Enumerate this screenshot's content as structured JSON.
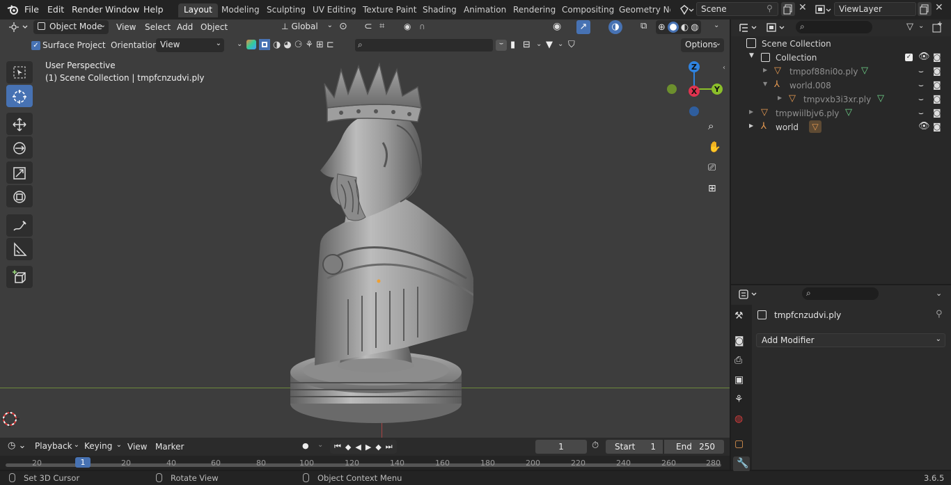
{
  "menu": {
    "items": [
      "File",
      "Edit",
      "Render",
      "Window",
      "Help"
    ]
  },
  "workspaces": [
    "Layout",
    "Modeling",
    "Sculpting",
    "UV Editing",
    "Texture Paint",
    "Shading",
    "Animation",
    "Rendering",
    "Compositing",
    "Geometry Noc"
  ],
  "scene": {
    "name": "Scene",
    "view_layer": "ViewLayer"
  },
  "viewport": {
    "mode": "Object Mode",
    "menus": [
      "View",
      "Select",
      "Add",
      "Object"
    ],
    "transform_orientation": "Global",
    "surface_project_label": "Surface Project",
    "orientation_label": "Orientation:",
    "orientation_value": "View",
    "options_label": "Options",
    "overlay_line1": "User Perspective",
    "overlay_line2": "(1) Scene Collection | tmpfcnzudvi.ply",
    "gizmo_axes": {
      "z": "Z",
      "x": "X",
      "y": "Y"
    }
  },
  "outliner": {
    "root": "Scene Collection",
    "rows": [
      {
        "label": "Collection"
      },
      {
        "label": "tmpof88ni0o.ply"
      },
      {
        "label": "world.008"
      },
      {
        "label": "tmpvxb3i3xr.ply"
      },
      {
        "label": "tmpwiilbjv6.ply"
      },
      {
        "label": "world"
      }
    ]
  },
  "properties": {
    "object_name": "tmpfcnzudvi.ply",
    "add_modifier_label": "Add Modifier"
  },
  "timeline": {
    "menus": [
      "Playback",
      "Keying",
      "View",
      "Marker"
    ],
    "current_frame": "1",
    "start_label": "Start",
    "start_value": "1",
    "end_label": "End",
    "end_value": "250",
    "ticks": [
      "20",
      "1",
      "20",
      "40",
      "60",
      "80",
      "100",
      "120",
      "140",
      "160",
      "180",
      "200",
      "220",
      "240",
      "260",
      "280"
    ]
  },
  "status": {
    "hint1": "Set 3D Cursor",
    "hint2": "Rotate View",
    "hint3": "Object Context Menu",
    "version": "3.6.5"
  },
  "colors": {
    "accent": "#4772b3",
    "viewport_bg": "#3d3d3d",
    "axis_x": "#e0334f",
    "axis_y": "#8bbf2a",
    "axis_z": "#2f83e0"
  }
}
